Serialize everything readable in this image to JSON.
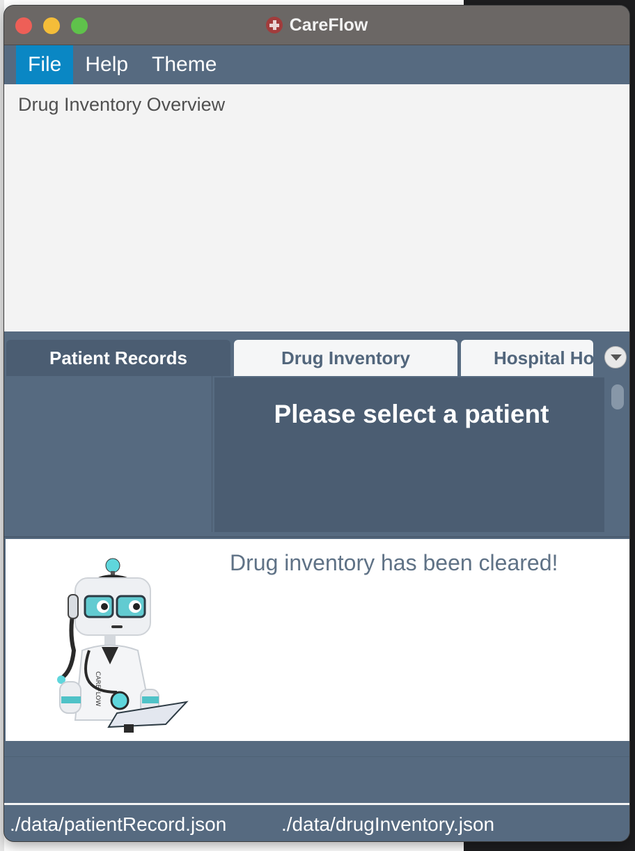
{
  "window": {
    "title": "CareFlow",
    "app_icon": "red-cross-icon"
  },
  "menu": {
    "items": [
      "File",
      "Help",
      "Theme"
    ],
    "active": "File"
  },
  "overview": {
    "label": "Drug Inventory Overview"
  },
  "tabs": [
    {
      "label": "Patient Records",
      "selected": true
    },
    {
      "label": "Drug Inventory",
      "selected": false
    },
    {
      "label": "Hospital Ho",
      "selected": false
    }
  ],
  "detail": {
    "placeholder": "Please select a patient"
  },
  "result": {
    "message": "Drug inventory has been cleared!",
    "mascot_text": "CAREFLOW"
  },
  "status": {
    "patient_file": "./data/patientRecord.json",
    "drug_file": "./data/drugInventory.json"
  },
  "colors": {
    "accent": "#0a87c4",
    "panel": "#566a80",
    "panel_dark": "#4b5d72"
  }
}
